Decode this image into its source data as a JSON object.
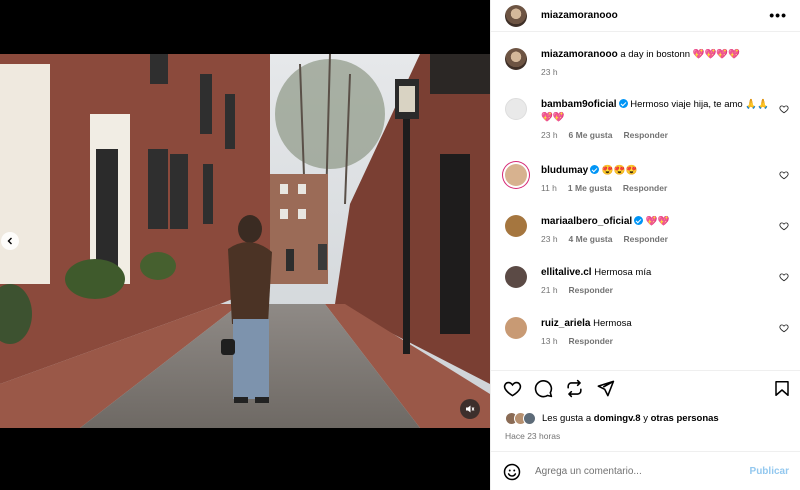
{
  "post": {
    "username": "miazamoranooo",
    "more_label": "•••"
  },
  "caption": {
    "username": "miazamoranooo",
    "text": "a day in bostonn 💖💖💖💖",
    "time": "23 h"
  },
  "comments": [
    {
      "username": "bambam9oficial",
      "verified": true,
      "text": "Hermoso viaje hija, te amo 🙏🙏💖💖",
      "time": "23 h",
      "likes": "6 Me gusta",
      "reply": "Responder",
      "avatar_color": "#e9e9e9"
    },
    {
      "username": "bludumay",
      "verified": true,
      "text": "😍😍😍",
      "time": "11 h",
      "likes": "1 Me gusta",
      "reply": "Responder",
      "avatar_color": "#d7b28f"
    },
    {
      "username": "mariaalbero_oficial",
      "verified": true,
      "text": "💖💖",
      "time": "23 h",
      "likes": "4 Me gusta",
      "reply": "Responder",
      "avatar_color": "#a5763f"
    },
    {
      "username": "ellitalive.cl",
      "verified": false,
      "text": "Hermosa mía",
      "time": "21 h",
      "likes": "",
      "reply": "Responder",
      "avatar_color": "#5b4a45"
    },
    {
      "username": "ruiz_ariela",
      "verified": false,
      "text": "Hermosa",
      "time": "13 h",
      "likes": "",
      "reply": "Responder",
      "avatar_color": "#c89a74"
    }
  ],
  "likes": {
    "prefix": "Les gusta a",
    "user": "domingv.8",
    "joiner": "y",
    "others": "otras personas"
  },
  "posted": "Hace 23 horas",
  "add_comment": {
    "placeholder": "Agrega un comentario...",
    "publish": "Publicar"
  },
  "colors": {
    "verified": "#0095f6",
    "heart": "#ed4956",
    "muted": "#737373",
    "publish": "#93c8ef"
  }
}
